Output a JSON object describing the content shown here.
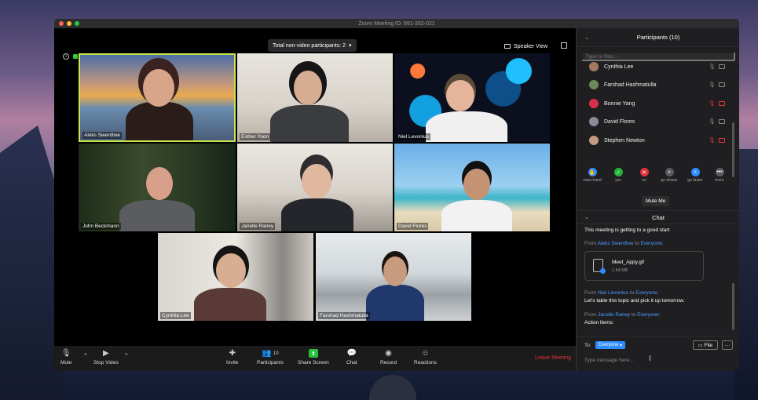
{
  "window": {
    "title": "Zoom Meeting ID: 991-332-021"
  },
  "header": {
    "nonvideo_label": "Total non-video participants: 2",
    "speaker_view_label": "Speaker View"
  },
  "tiles": [
    {
      "name": "Aleks Swerdlow"
    },
    {
      "name": "Esther Yoon"
    },
    {
      "name": "Niel Levonius"
    },
    {
      "name": "John Beckmann"
    },
    {
      "name": "Janelle Raney"
    },
    {
      "name": "David Flores"
    },
    {
      "name": "Cynthia Lee"
    },
    {
      "name": "Farshad Hashmatulla"
    }
  ],
  "toolbar": {
    "mute": "Mute",
    "stop_video": "Stop Video",
    "invite": "Invite",
    "participants": "Participants",
    "participants_count": "10",
    "share_screen": "Share Screen",
    "chat": "Chat",
    "record": "Record",
    "reactions": "Reactions",
    "leave": "Leave Meeting"
  },
  "participants_panel": {
    "title": "Participants (10)",
    "filter_placeholder": "Type to filter...",
    "list": [
      {
        "name": "Cynthia Lee",
        "muted": false
      },
      {
        "name": "Farshad Hashmatulla",
        "muted": false
      },
      {
        "name": "Bonnie Yang",
        "muted": true
      },
      {
        "name": "David Flores",
        "muted": false
      },
      {
        "name": "Stephen Newton",
        "muted": true
      }
    ],
    "reactions": [
      "raise hand",
      "yes",
      "no",
      "go slower",
      "go faster",
      "more"
    ],
    "mute_me": "Mute Me"
  },
  "chat_panel": {
    "title": "Chat",
    "first_message": "This meeting is getting to a good start",
    "messages": [
      {
        "from_prefix": "From",
        "sender": "Aleks Swerdlow",
        "to_word": "to",
        "recipient": "Everyone:"
      },
      {
        "from_prefix": "From",
        "sender": "Niel Levonius",
        "to_word": "to",
        "recipient": "Everyone:",
        "text": "Let's table this topic and pick it up tomorrow."
      },
      {
        "from_prefix": "From",
        "sender": "Janelle Raney",
        "to_word": "to",
        "recipient": "Everyone:",
        "text": "Action Items:"
      }
    ],
    "file": {
      "name": "Meet_Appy.gif",
      "size": "1.54 MB"
    },
    "to_label": "To:",
    "to_value": "Everyone",
    "file_button": "File",
    "more_button": "···",
    "input_placeholder": "Type message here..."
  },
  "colors": {
    "accent": "#2d8cff",
    "danger": "#e0333b",
    "active_speaker": "#c8e64a"
  }
}
